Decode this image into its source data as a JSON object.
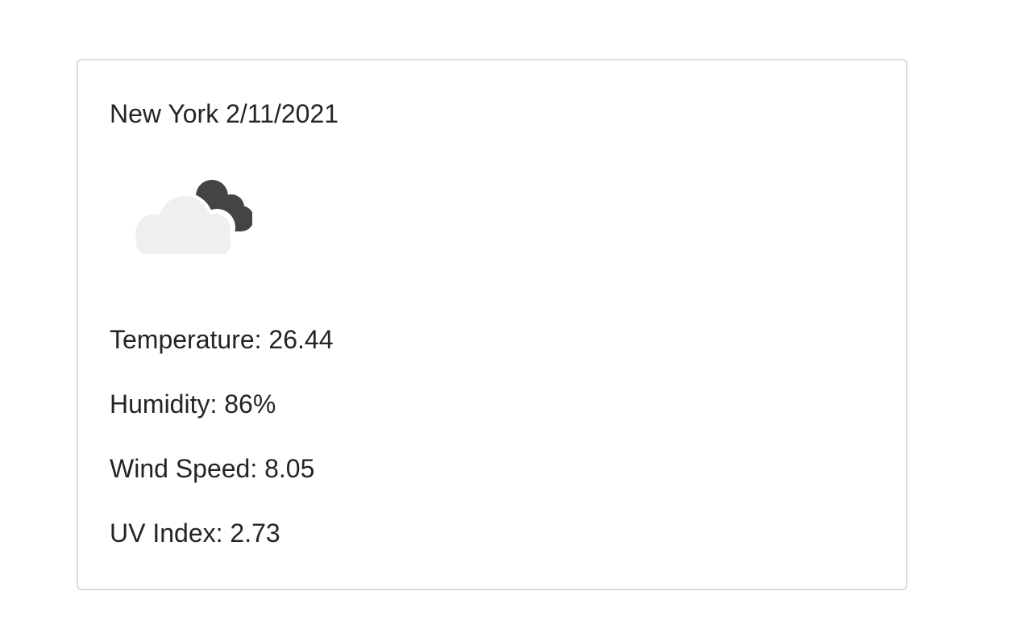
{
  "weather": {
    "title": "New York 2/11/2021",
    "icon": "broken-clouds-icon",
    "temperature": "Temperature: 26.44",
    "humidity": "Humidity: 86%",
    "wind_speed": "Wind Speed: 8.05",
    "uv_index": "UV Index: 2.73"
  },
  "colors": {
    "card_border": "#dcdcdc",
    "text": "#212529",
    "cloud_light": "#efefed",
    "cloud_dark": "#444446"
  }
}
